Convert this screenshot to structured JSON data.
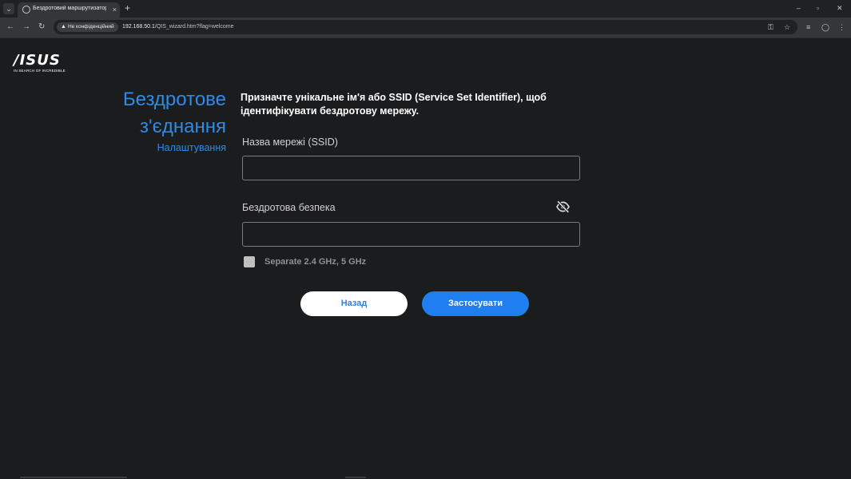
{
  "browser": {
    "tab": {
      "title": "Бездротовий маршрутизатор A",
      "close": "×"
    },
    "tab_list": "⌄",
    "new_tab": "+",
    "window": {
      "minimize": "–",
      "maximize": "▫",
      "close": "✕"
    },
    "nav": {
      "back": "←",
      "forward": "→",
      "reload": "↻"
    },
    "security_label": "Не конфіденційний",
    "url_host": "192.168.50.1",
    "url_path": "/QIS_wizard.htm?flag=welcome",
    "icons": [
      "back-icon",
      "forward-icon",
      "reload-icon",
      "warning-icon",
      "key-icon",
      "star-icon",
      "extensions-icon",
      "profile-icon",
      "menu-icon"
    ]
  },
  "logo": {
    "text": "/ISUS",
    "tagline": "IN SEARCH OF INCREDIBLE"
  },
  "sidebar": {
    "title_line1": "Бездротове",
    "title_line2": "з'єднання",
    "subtitle": "Налаштування"
  },
  "form": {
    "description": "Призначте унікальне ім'я або SSID (Service Set Identifier), щоб ідентифікувати бездротову мережу.",
    "ssid_label": "Назва мережі (SSID)",
    "ssid_value": "",
    "security_label": "Бездротова безпека",
    "security_value": "",
    "separate_label": "Separate 2.4 GHz, 5 GHz",
    "separate_checked": false
  },
  "buttons": {
    "back": "Назад",
    "apply": "Застосувати"
  },
  "colors": {
    "accent": "#2f8ae8",
    "apply_button": "#1f7ff0",
    "background": "#1b1c1e"
  }
}
